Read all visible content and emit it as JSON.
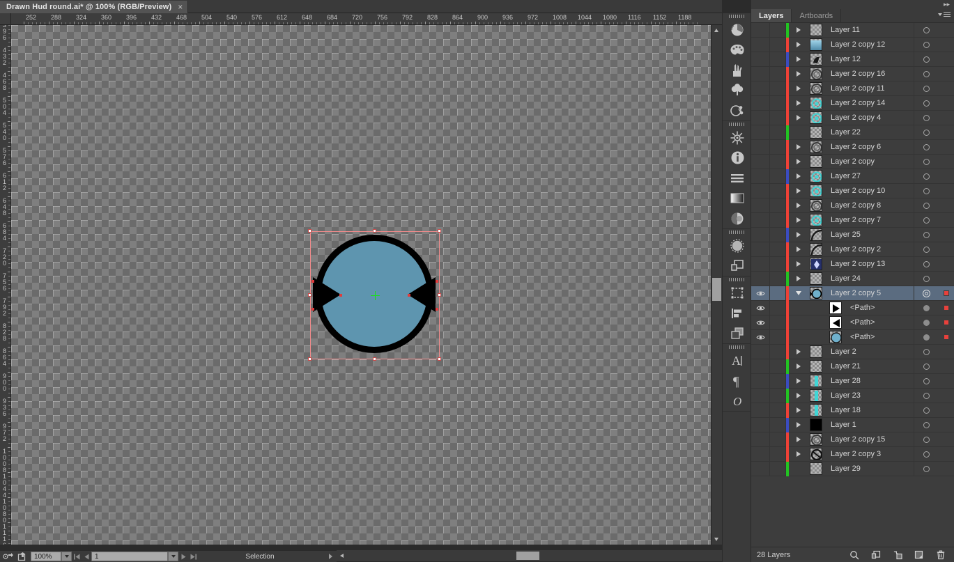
{
  "document": {
    "tab_title": "Drawn Hud round.ai* @ 100% (RGB/Preview)",
    "close_label": "×"
  },
  "rulers": {
    "horizontal_ticks": [
      252,
      288,
      324,
      360,
      396,
      432,
      468,
      504,
      540,
      576,
      612,
      648,
      684,
      720,
      756,
      792,
      828,
      864,
      900,
      936,
      972,
      1008,
      1044,
      1080,
      1116,
      1152,
      1188
    ],
    "vertical_ticks": [
      396,
      432,
      468,
      504,
      540,
      576,
      612,
      648,
      684,
      720,
      756,
      792,
      828,
      864,
      900,
      936,
      972,
      1008,
      1044,
      1080,
      1116
    ],
    "unit_spacing_px": 36
  },
  "artwork": {
    "description": "black outlined circle with blue fill and two inward pointing triangles",
    "fill_color": "#5e95af",
    "stroke_color": "#000000",
    "selection_color": "#f08b8b",
    "anchor_color": "#e03c3c",
    "center_marker_color": "#19e219"
  },
  "dock": {
    "groups": [
      {
        "icons": [
          "color-guide-icon",
          "color-palette-icon",
          "brushes-icon",
          "symbols-icon",
          "graphic-styles-icon"
        ]
      },
      {
        "icons": [
          "transform-icon",
          "info-icon",
          "align-icon",
          "gradient-icon",
          "transparency-icon"
        ]
      },
      {
        "icons": [
          "appearance-icon",
          "pathfinder-icon"
        ]
      },
      {
        "icons": [
          "artboards-icon",
          "align-panel-icon",
          "layers-dock-icon"
        ]
      },
      {
        "icons": [
          "character-icon",
          "paragraph-icon",
          "opentype-icon"
        ]
      }
    ]
  },
  "panel": {
    "tabs": [
      {
        "label": "Layers",
        "active": true
      },
      {
        "label": "Artboards",
        "active": false
      }
    ],
    "menu_icon": "panel-menu-icon",
    "collapse_icon": "expand-panels-icon",
    "footer": {
      "count_label": "28 Layers",
      "icons": [
        "locate-object-icon",
        "make-clipping-mask-icon",
        "create-new-sublayer-icon",
        "create-new-layer-icon",
        "delete-selection-icon"
      ]
    },
    "layers": [
      {
        "name": "Layer 11",
        "color": "#22c322",
        "expandable": true,
        "expanded": false,
        "visible": false,
        "selected": false,
        "child": false,
        "thumb": "empty"
      },
      {
        "name": "Layer 2 copy 12",
        "color": "#ef4136",
        "expandable": true,
        "expanded": false,
        "visible": false,
        "selected": false,
        "child": false,
        "thumb": "blue"
      },
      {
        "name": "Layer 12",
        "color": "#3b4cc0",
        "expandable": true,
        "expanded": false,
        "visible": false,
        "selected": false,
        "child": false,
        "thumb": "dark"
      },
      {
        "name": "Layer 2 copy 16",
        "color": "#ef4136",
        "expandable": true,
        "expanded": false,
        "visible": false,
        "selected": false,
        "child": false,
        "thumb": "ring"
      },
      {
        "name": "Layer 2 copy 11",
        "color": "#ef4136",
        "expandable": true,
        "expanded": false,
        "visible": false,
        "selected": false,
        "child": false,
        "thumb": "ring"
      },
      {
        "name": "Layer 2 copy 14",
        "color": "#ef4136",
        "expandable": true,
        "expanded": false,
        "visible": false,
        "selected": false,
        "child": false,
        "thumb": "cyan"
      },
      {
        "name": "Layer 2 copy 4",
        "color": "#ef4136",
        "expandable": true,
        "expanded": false,
        "visible": false,
        "selected": false,
        "child": false,
        "thumb": "cyan"
      },
      {
        "name": "Layer 22",
        "color": "#22c322",
        "expandable": false,
        "expanded": false,
        "visible": false,
        "selected": false,
        "child": false,
        "thumb": "empty"
      },
      {
        "name": "Layer 2 copy 6",
        "color": "#ef4136",
        "expandable": true,
        "expanded": false,
        "visible": false,
        "selected": false,
        "child": false,
        "thumb": "ring"
      },
      {
        "name": "Layer 2 copy",
        "color": "#ef4136",
        "expandable": true,
        "expanded": false,
        "visible": false,
        "selected": false,
        "child": false,
        "thumb": "empty"
      },
      {
        "name": "Layer 27",
        "color": "#3b4cc0",
        "expandable": true,
        "expanded": false,
        "visible": false,
        "selected": false,
        "child": false,
        "thumb": "cyan"
      },
      {
        "name": "Layer 2 copy 10",
        "color": "#ef4136",
        "expandable": true,
        "expanded": false,
        "visible": false,
        "selected": false,
        "child": false,
        "thumb": "cyan"
      },
      {
        "name": "Layer 2 copy 8",
        "color": "#ef4136",
        "expandable": true,
        "expanded": false,
        "visible": false,
        "selected": false,
        "child": false,
        "thumb": "ring"
      },
      {
        "name": "Layer 2 copy 7",
        "color": "#ef4136",
        "expandable": true,
        "expanded": false,
        "visible": false,
        "selected": false,
        "child": false,
        "thumb": "cyan"
      },
      {
        "name": "Layer 25",
        "color": "#3b4cc0",
        "expandable": true,
        "expanded": false,
        "visible": false,
        "selected": false,
        "child": false,
        "thumb": "arc"
      },
      {
        "name": "Layer 2 copy 2",
        "color": "#ef4136",
        "expandable": true,
        "expanded": false,
        "visible": false,
        "selected": false,
        "child": false,
        "thumb": "arc"
      },
      {
        "name": "Layer 2 copy 13",
        "color": "#ef4136",
        "expandable": true,
        "expanded": false,
        "visible": false,
        "selected": false,
        "child": false,
        "thumb": "navy"
      },
      {
        "name": "Layer 24",
        "color": "#22c322",
        "expandable": true,
        "expanded": false,
        "visible": false,
        "selected": false,
        "child": false,
        "thumb": "empty"
      },
      {
        "name": "Layer 2 copy 5",
        "color": "#ef4136",
        "expandable": true,
        "expanded": true,
        "visible": true,
        "selected": true,
        "child": false,
        "thumb": "hud"
      },
      {
        "name": "<Path>",
        "color": "#ef4136",
        "expandable": false,
        "expanded": false,
        "visible": true,
        "selected": false,
        "child": true,
        "thumb": "tri-right"
      },
      {
        "name": "<Path>",
        "color": "#ef4136",
        "expandable": false,
        "expanded": false,
        "visible": true,
        "selected": false,
        "child": true,
        "thumb": "tri-left"
      },
      {
        "name": "<Path>",
        "color": "#ef4136",
        "expandable": false,
        "expanded": false,
        "visible": true,
        "selected": false,
        "child": true,
        "thumb": "circle"
      },
      {
        "name": "Layer 2",
        "color": "#ef4136",
        "expandable": true,
        "expanded": false,
        "visible": false,
        "selected": false,
        "child": false,
        "thumb": "empty"
      },
      {
        "name": "Layer 21",
        "color": "#22c322",
        "expandable": true,
        "expanded": false,
        "visible": false,
        "selected": false,
        "child": false,
        "thumb": "empty"
      },
      {
        "name": "Layer 28",
        "color": "#3b4cc0",
        "expandable": true,
        "expanded": false,
        "visible": false,
        "selected": false,
        "child": false,
        "thumb": "cyanbar"
      },
      {
        "name": "Layer 23",
        "color": "#22c322",
        "expandable": true,
        "expanded": false,
        "visible": false,
        "selected": false,
        "child": false,
        "thumb": "cyanbar"
      },
      {
        "name": "Layer 18",
        "color": "#ef4136",
        "expandable": true,
        "expanded": false,
        "visible": false,
        "selected": false,
        "child": false,
        "thumb": "cyanbar"
      },
      {
        "name": "Layer 1",
        "color": "#3b4cc0",
        "expandable": true,
        "expanded": false,
        "visible": false,
        "selected": false,
        "child": false,
        "thumb": "black"
      },
      {
        "name": "Layer 2 copy 15",
        "color": "#ef4136",
        "expandable": true,
        "expanded": false,
        "visible": false,
        "selected": false,
        "child": false,
        "thumb": "ring"
      },
      {
        "name": "Layer 2 copy 3",
        "color": "#ef4136",
        "expandable": true,
        "expanded": false,
        "visible": false,
        "selected": false,
        "child": false,
        "thumb": "ring2"
      },
      {
        "name": "Layer 29",
        "color": "#22c322",
        "expandable": false,
        "expanded": false,
        "visible": false,
        "selected": false,
        "child": false,
        "thumb": "empty"
      }
    ]
  },
  "statusbar": {
    "zoom_value": "100%",
    "artboard_value": "1",
    "status_label": "Selection",
    "icons": [
      "preview-mode-icon",
      "share-icon",
      "first-artboard-icon",
      "prev-artboard-icon",
      "next-artboard-icon",
      "last-artboard-icon"
    ]
  }
}
